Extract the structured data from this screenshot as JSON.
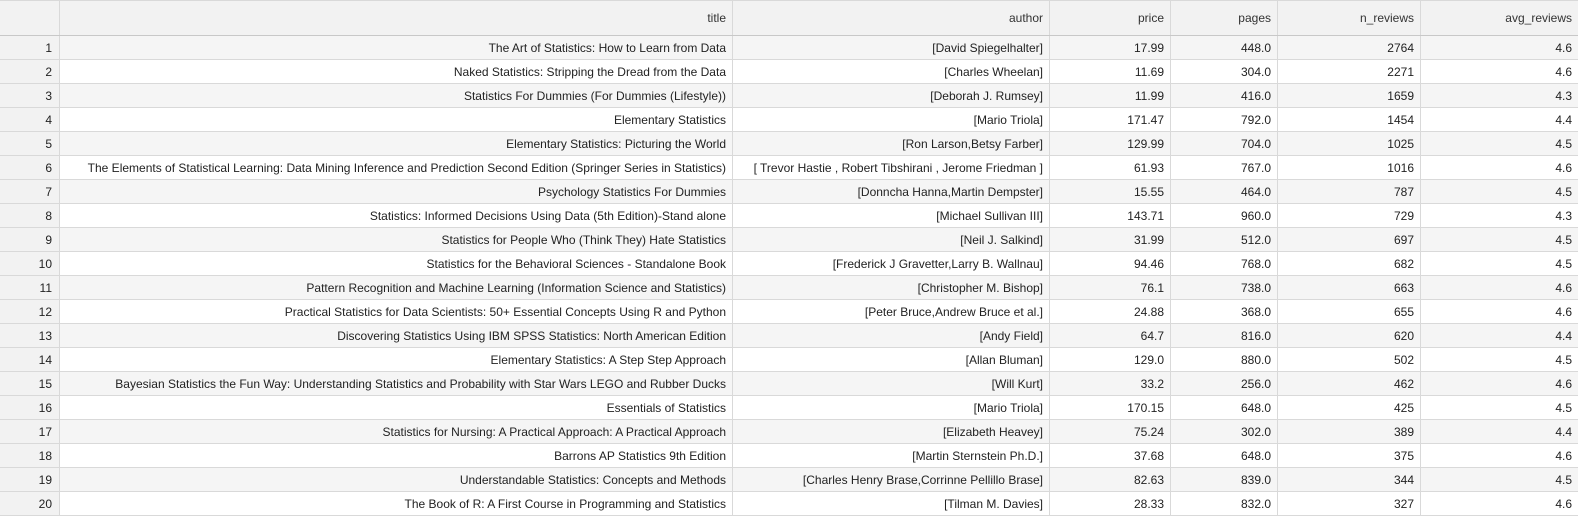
{
  "columns": [
    "title",
    "author",
    "price",
    "pages",
    "n_reviews",
    "avg_reviews"
  ],
  "rows": [
    {
      "index": "1",
      "title": "The Art of Statistics: How to Learn from Data",
      "author": "[David Spiegelhalter]",
      "price": "17.99",
      "pages": "448.0",
      "n_reviews": "2764",
      "avg_reviews": "4.6"
    },
    {
      "index": "2",
      "title": "Naked Statistics: Stripping the Dread from the Data",
      "author": "[Charles Wheelan]",
      "price": "11.69",
      "pages": "304.0",
      "n_reviews": "2271",
      "avg_reviews": "4.6"
    },
    {
      "index": "3",
      "title": "Statistics For Dummies (For Dummies (Lifestyle))",
      "author": "[Deborah J. Rumsey]",
      "price": "11.99",
      "pages": "416.0",
      "n_reviews": "1659",
      "avg_reviews": "4.3"
    },
    {
      "index": "4",
      "title": "Elementary Statistics",
      "author": "[Mario Triola]",
      "price": "171.47",
      "pages": "792.0",
      "n_reviews": "1454",
      "avg_reviews": "4.4"
    },
    {
      "index": "5",
      "title": "Elementary Statistics: Picturing the World",
      "author": "[Ron Larson,Betsy Farber]",
      "price": "129.99",
      "pages": "704.0",
      "n_reviews": "1025",
      "avg_reviews": "4.5"
    },
    {
      "index": "6",
      "title": "The Elements of Statistical Learning: Data Mining Inference and Prediction Second Edition (Springer Series in Statistics)",
      "author": "[ Trevor Hastie , Robert Tibshirani , Jerome Friedman ]",
      "price": "61.93",
      "pages": "767.0",
      "n_reviews": "1016",
      "avg_reviews": "4.6"
    },
    {
      "index": "7",
      "title": "Psychology Statistics For Dummies",
      "author": "[Donncha Hanna,Martin Dempster]",
      "price": "15.55",
      "pages": "464.0",
      "n_reviews": "787",
      "avg_reviews": "4.5"
    },
    {
      "index": "8",
      "title": "Statistics: Informed Decisions Using Data (5th Edition)-Stand alone",
      "author": "[Michael Sullivan III]",
      "price": "143.71",
      "pages": "960.0",
      "n_reviews": "729",
      "avg_reviews": "4.3"
    },
    {
      "index": "9",
      "title": "Statistics for People Who (Think They) Hate Statistics",
      "author": "[Neil J. Salkind]",
      "price": "31.99",
      "pages": "512.0",
      "n_reviews": "697",
      "avg_reviews": "4.5"
    },
    {
      "index": "10",
      "title": "Statistics for the Behavioral Sciences - Standalone Book",
      "author": "[Frederick J Gravetter,Larry B. Wallnau]",
      "price": "94.46",
      "pages": "768.0",
      "n_reviews": "682",
      "avg_reviews": "4.5"
    },
    {
      "index": "11",
      "title": "Pattern Recognition and Machine Learning (Information Science and Statistics)",
      "author": "[Christopher M. Bishop]",
      "price": "76.1",
      "pages": "738.0",
      "n_reviews": "663",
      "avg_reviews": "4.6"
    },
    {
      "index": "12",
      "title": "Practical Statistics for Data Scientists: 50+ Essential Concepts Using R and Python",
      "author": "[Peter Bruce,Andrew Bruce et al.]",
      "price": "24.88",
      "pages": "368.0",
      "n_reviews": "655",
      "avg_reviews": "4.6"
    },
    {
      "index": "13",
      "title": "Discovering Statistics Using IBM SPSS Statistics: North American Edition",
      "author": "[Andy Field]",
      "price": "64.7",
      "pages": "816.0",
      "n_reviews": "620",
      "avg_reviews": "4.4"
    },
    {
      "index": "14",
      "title": "Elementary Statistics: A Step Step Approach",
      "author": "[Allan Bluman]",
      "price": "129.0",
      "pages": "880.0",
      "n_reviews": "502",
      "avg_reviews": "4.5"
    },
    {
      "index": "15",
      "title": "Bayesian Statistics the Fun Way: Understanding Statistics and Probability with Star Wars LEGO and Rubber Ducks",
      "author": "[Will Kurt]",
      "price": "33.2",
      "pages": "256.0",
      "n_reviews": "462",
      "avg_reviews": "4.6"
    },
    {
      "index": "16",
      "title": "Essentials of Statistics",
      "author": "[Mario Triola]",
      "price": "170.15",
      "pages": "648.0",
      "n_reviews": "425",
      "avg_reviews": "4.5"
    },
    {
      "index": "17",
      "title": "Statistics for Nursing: A Practical Approach: A Practical Approach",
      "author": "[Elizabeth Heavey]",
      "price": "75.24",
      "pages": "302.0",
      "n_reviews": "389",
      "avg_reviews": "4.4"
    },
    {
      "index": "18",
      "title": "Barrons AP Statistics 9th Edition",
      "author": "[Martin Sternstein Ph.D.]",
      "price": "37.68",
      "pages": "648.0",
      "n_reviews": "375",
      "avg_reviews": "4.6"
    },
    {
      "index": "19",
      "title": "Understandable Statistics: Concepts and Methods",
      "author": "[Charles Henry Brase,Corrinne Pellillo Brase]",
      "price": "82.63",
      "pages": "839.0",
      "n_reviews": "344",
      "avg_reviews": "4.5"
    },
    {
      "index": "20",
      "title": "The Book of R: A First Course in Programming and Statistics",
      "author": "[Tilman M. Davies]",
      "price": "28.33",
      "pages": "832.0",
      "n_reviews": "327",
      "avg_reviews": "4.6"
    }
  ]
}
